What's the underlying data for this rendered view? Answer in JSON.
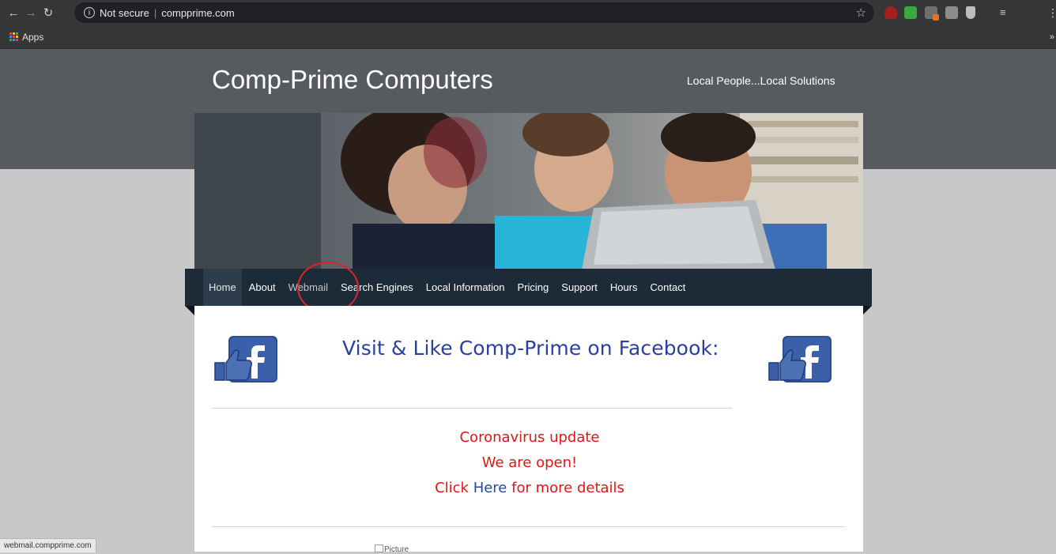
{
  "browser": {
    "security_label": "Not secure",
    "url": "compprime.com",
    "bookmarks_apps_label": "Apps",
    "more_bookmarks": "»"
  },
  "site": {
    "title": "Comp-Prime Computers",
    "tagline": "Local People...Local Solutions"
  },
  "nav": {
    "items": [
      "Home",
      "About",
      "Webmail",
      "Search Engines",
      "Local Information",
      "Pricing",
      "Support",
      "Hours",
      "Contact"
    ]
  },
  "content": {
    "facebook_heading": "Visit & Like Comp-Prime on Facebook:",
    "corona_line1": "Coronavirus update",
    "corona_line2": "We are open!",
    "corona_click": "Click",
    "corona_here": "Here",
    "corona_rest": "for more details",
    "broken_image_alt": "Picture"
  },
  "status": {
    "hover_url": "webmail.compprime.com"
  },
  "colors": {
    "header_bg": "#575b5f",
    "nav_bg": "#1d2a38",
    "heading_blue": "#2a3fa2",
    "alert_red": "#e01616",
    "annotation_circle": "#d8242d"
  }
}
